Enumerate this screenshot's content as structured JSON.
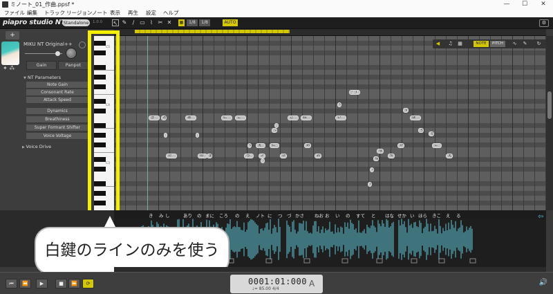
{
  "window": {
    "title": "ミノート_01_作曲.ppsf *",
    "controls": [
      "—",
      "☐",
      "✕"
    ]
  },
  "menu": [
    "ファイル",
    "編集",
    "トラック",
    "リージョン",
    "ノート",
    "表示",
    "再生",
    "設定",
    "ヘルプ"
  ],
  "toolbar": {
    "logo": "piapro studio NT2",
    "standalone_label": "Standalone",
    "version": "1.0.0",
    "quantize": "1/8",
    "tool_icons": [
      "cursor-icon",
      "pencil-icon",
      "line-icon",
      "eraser-icon",
      "brush-icon",
      "scissors-icon",
      "x-icon"
    ]
  },
  "track": {
    "add_label": "+",
    "singer_name": "MIKU NT Original++",
    "gain_label": "Gain",
    "panpot_label": "Panpot",
    "params_header": "NT Parameters",
    "nt_params": [
      "Note Gain",
      "Consonant Rate",
      "Attack Speed"
    ],
    "other_params": [
      "Dynamics",
      "Breathiness",
      "Super Formant Shifter",
      "Voice Voltage"
    ],
    "voice_drive": "Voice Drive"
  },
  "keyboard": {
    "c_labels": [
      "C5",
      "C4",
      "C3"
    ]
  },
  "edit_modes": {
    "note": "NOTE",
    "pitch": "PITCH"
  },
  "notes": [
    {
      "text": "き",
      "lbl": "ki"
    },
    {
      "text": "み",
      "lbl": ""
    },
    {
      "text": "し",
      "lbl": ""
    },
    {
      "text": "た",
      "lbl": ""
    },
    {
      "text": "あ",
      "lbl": ""
    },
    {
      "text": "り",
      "lbl": ""
    },
    {
      "text": "の",
      "lbl": ""
    },
    {
      "text": "ま",
      "lbl": ""
    },
    {
      "text": "に",
      "lbl": ""
    },
    {
      "text": "こ",
      "lbl": ""
    },
    {
      "text": "ろ",
      "lbl": ""
    },
    {
      "text": "の",
      "lbl": ""
    },
    {
      "text": "え",
      "lbl": ""
    },
    {
      "text": "ノ",
      "lbl": ""
    },
    {
      "text": "ト",
      "lbl": ""
    },
    {
      "text": "に",
      "lbl": ""
    },
    {
      "text": "つ",
      "lbl": ""
    },
    {
      "text": "づ",
      "lbl": ""
    },
    {
      "text": "か",
      "lbl": ""
    },
    {
      "text": "さ",
      "lbl": ""
    },
    {
      "text": "ね",
      "lbl": ""
    },
    {
      "text": "お",
      "lbl": ""
    },
    {
      "text": "お",
      "lbl": ""
    },
    {
      "text": "い",
      "lbl": ""
    },
    {
      "text": "の",
      "lbl": ""
    },
    {
      "text": "す",
      "lbl": ""
    },
    {
      "text": "て",
      "lbl": ""
    },
    {
      "text": "と",
      "lbl": ""
    },
    {
      "text": "は",
      "lbl": ""
    },
    {
      "text": "な",
      "lbl": ""
    },
    {
      "text": "せ",
      "lbl": ""
    },
    {
      "text": "か",
      "lbl": ""
    },
    {
      "text": "い",
      "lbl": ""
    },
    {
      "text": "ほ",
      "lbl": ""
    },
    {
      "text": "ら",
      "lbl": ""
    },
    {
      "text": "き",
      "lbl": ""
    },
    {
      "text": "こ",
      "lbl": ""
    },
    {
      "text": "え",
      "lbl": ""
    },
    {
      "text": "る",
      "lbl": ""
    }
  ],
  "lyrics": [
    "き",
    "み",
    "し",
    "あり",
    "の",
    "まに",
    "ころ",
    "の",
    "え",
    "ノト",
    "に",
    "つ",
    "づ",
    "かさ",
    "ねお",
    "お",
    "い",
    "の",
    "すて",
    "と",
    "はな",
    "せか",
    "い",
    "ほら",
    "きこ",
    "え",
    "る"
  ],
  "callout": "白鍵のラインのみを使う",
  "transport": {
    "rewind": "⏮",
    "back": "⏪",
    "play": "▶",
    "stop": "■",
    "forward": "⏩",
    "loop": "⟳",
    "position": "0001:01:000",
    "tempo": "♩= 85.00  4/4",
    "a_label": "A",
    "speaker": "🔊"
  }
}
